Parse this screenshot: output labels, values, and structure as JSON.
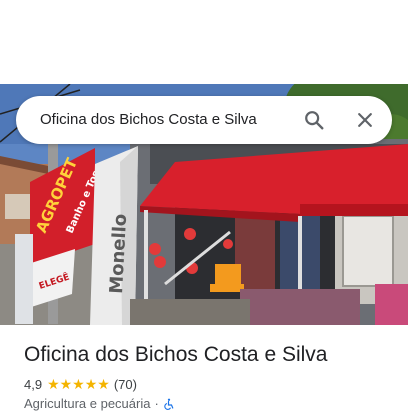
{
  "search": {
    "query": "Oficina dos Bichos Costa e Silva"
  },
  "photo": {
    "sign_left_lines": [
      "AGROPET",
      "Banho e Tosa"
    ],
    "sign_left_small": "ELEGÊ",
    "banner_right": "Monello"
  },
  "place": {
    "title": "Oficina dos Bichos Costa e Silva",
    "rating": "4,9",
    "stars": "★★★★★",
    "reviews": "(70)",
    "category": "Agricultura e pecuária",
    "separator": "·"
  },
  "icons": {
    "search": "search-icon",
    "close": "close-icon",
    "accessibility": "wheelchair-icon"
  },
  "colors": {
    "star": "#f4b400",
    "accessibility": "#1a73e8",
    "tent": "#d8202c"
  }
}
